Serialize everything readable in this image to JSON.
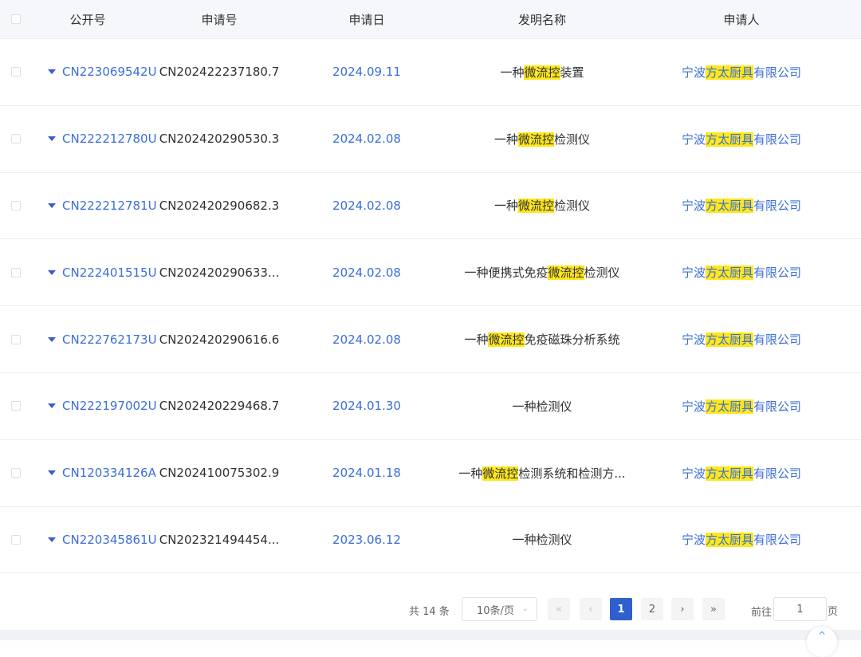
{
  "headers": {
    "pub_no": "公开号",
    "app_no": "申请号",
    "app_date": "申请日",
    "title": "发明名称",
    "applicant": "申请人"
  },
  "rows": [
    {
      "pub": "CN223069542U",
      "app": "CN202422237180.7",
      "date": "2024.09.11",
      "title": [
        [
          "一种",
          false
        ],
        [
          "微流控",
          true
        ],
        [
          "装置",
          false
        ]
      ],
      "owner": [
        [
          "宁波",
          false
        ],
        [
          "方太厨具",
          true
        ],
        [
          "有限公司",
          false
        ]
      ]
    },
    {
      "pub": "CN222212780U",
      "app": "CN202420290530.3",
      "date": "2024.02.08",
      "title": [
        [
          "一种",
          false
        ],
        [
          "微流控",
          true
        ],
        [
          "检测仪",
          false
        ]
      ],
      "owner": [
        [
          "宁波",
          false
        ],
        [
          "方太厨具",
          true
        ],
        [
          "有限公司",
          false
        ]
      ]
    },
    {
      "pub": "CN222212781U",
      "app": "CN202420290682.3",
      "date": "2024.02.08",
      "title": [
        [
          "一种",
          false
        ],
        [
          "微流控",
          true
        ],
        [
          "检测仪",
          false
        ]
      ],
      "owner": [
        [
          "宁波",
          false
        ],
        [
          "方太厨具",
          true
        ],
        [
          "有限公司",
          false
        ]
      ]
    },
    {
      "pub": "CN222401515U",
      "app": "CN202420290633...",
      "date": "2024.02.08",
      "title": [
        [
          "一种便携式免疫",
          false
        ],
        [
          "微流控",
          true
        ],
        [
          "检测仪",
          false
        ]
      ],
      "owner": [
        [
          "宁波",
          false
        ],
        [
          "方太厨具",
          true
        ],
        [
          "有限公司",
          false
        ]
      ]
    },
    {
      "pub": "CN222762173U",
      "app": "CN202420290616.6",
      "date": "2024.02.08",
      "title": [
        [
          "一种",
          false
        ],
        [
          "微流控",
          true
        ],
        [
          "免疫磁珠分析系统",
          false
        ]
      ],
      "owner": [
        [
          "宁波",
          false
        ],
        [
          "方太厨具",
          true
        ],
        [
          "有限公司",
          false
        ]
      ]
    },
    {
      "pub": "CN222197002U",
      "app": "CN202420229468.7",
      "date": "2024.01.30",
      "title": [
        [
          "一种检测仪",
          false
        ]
      ],
      "owner": [
        [
          "宁波",
          false
        ],
        [
          "方太厨具",
          true
        ],
        [
          "有限公司",
          false
        ]
      ]
    },
    {
      "pub": "CN120334126A",
      "app": "CN202410075302.9",
      "date": "2024.01.18",
      "title": [
        [
          "一种",
          false
        ],
        [
          "微流控",
          true
        ],
        [
          "检测系统和检测方...",
          false
        ]
      ],
      "owner": [
        [
          "宁波",
          false
        ],
        [
          "方太厨具",
          true
        ],
        [
          "有限公司",
          false
        ]
      ]
    },
    {
      "pub": "CN220345861U",
      "app": "CN202321494454...",
      "date": "2023.06.12",
      "title": [
        [
          "一种检测仪",
          false
        ]
      ],
      "owner": [
        [
          "宁波",
          false
        ],
        [
          "方太厨具",
          true
        ],
        [
          "有限公司",
          false
        ]
      ]
    }
  ],
  "pagination": {
    "total": "共 14 条",
    "page_size": "10条/页",
    "size_arrow": "⌄",
    "first": "«",
    "prev": "‹",
    "pages": [
      "1",
      "2"
    ],
    "next": "›",
    "last": "»",
    "goto_label": "前往",
    "goto_value": "1",
    "page_suffix": "页"
  },
  "back_to_top": "^",
  "colors": {
    "link": "#3b6ed8",
    "highlight": "#ffe71a",
    "active_page": "#2f5fcf"
  }
}
